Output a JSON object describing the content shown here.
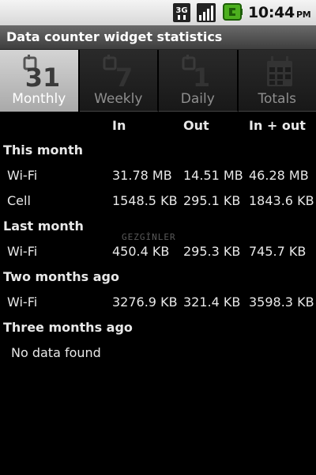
{
  "status_bar": {
    "time": "10:44",
    "ampm": "PM",
    "network_type": "3G",
    "icons": [
      "3g-data-icon",
      "signal-strength-icon",
      "battery-charging-icon"
    ]
  },
  "title": "Data counter widget statistics",
  "tabs": [
    {
      "label": "Monthly",
      "icon": "calendar-31-icon",
      "icon_text": "31",
      "active": true
    },
    {
      "label": "Weekly",
      "icon": "calendar-7-icon",
      "icon_text": "7",
      "active": false
    },
    {
      "label": "Daily",
      "icon": "calendar-1-icon",
      "icon_text": "1",
      "active": false
    },
    {
      "label": "Totals",
      "icon": "calendar-grid-icon",
      "icon_text": "",
      "active": false
    }
  ],
  "columns": {
    "in": "In",
    "out": "Out",
    "sum": "In + out"
  },
  "sections": [
    {
      "title": "This month",
      "rows": [
        {
          "label": "Wi-Fi",
          "in": "31.78 MB",
          "out": "14.51 MB",
          "sum": "46.28 MB"
        },
        {
          "label": "Cell",
          "in": "1548.5 KB",
          "out": "295.1 KB",
          "sum": "1843.6 KB"
        }
      ]
    },
    {
      "title": "Last month",
      "rows": [
        {
          "label": "Wi-Fi",
          "in": "450.4 KB",
          "out": "295.3 KB",
          "sum": "745.7 KB"
        }
      ]
    },
    {
      "title": "Two months ago",
      "rows": [
        {
          "label": "Wi-Fi",
          "in": "3276.9 KB",
          "out": "321.4 KB",
          "sum": "3598.3 KB"
        }
      ]
    },
    {
      "title": "Three months ago",
      "empty_text": "No data found"
    }
  ],
  "watermark": "GEZGİNLER",
  "colors": {
    "background": "#000000",
    "active_tab": "#c4c4c4",
    "inactive_tab": "#222222",
    "battery_green": "#4caf1e"
  }
}
